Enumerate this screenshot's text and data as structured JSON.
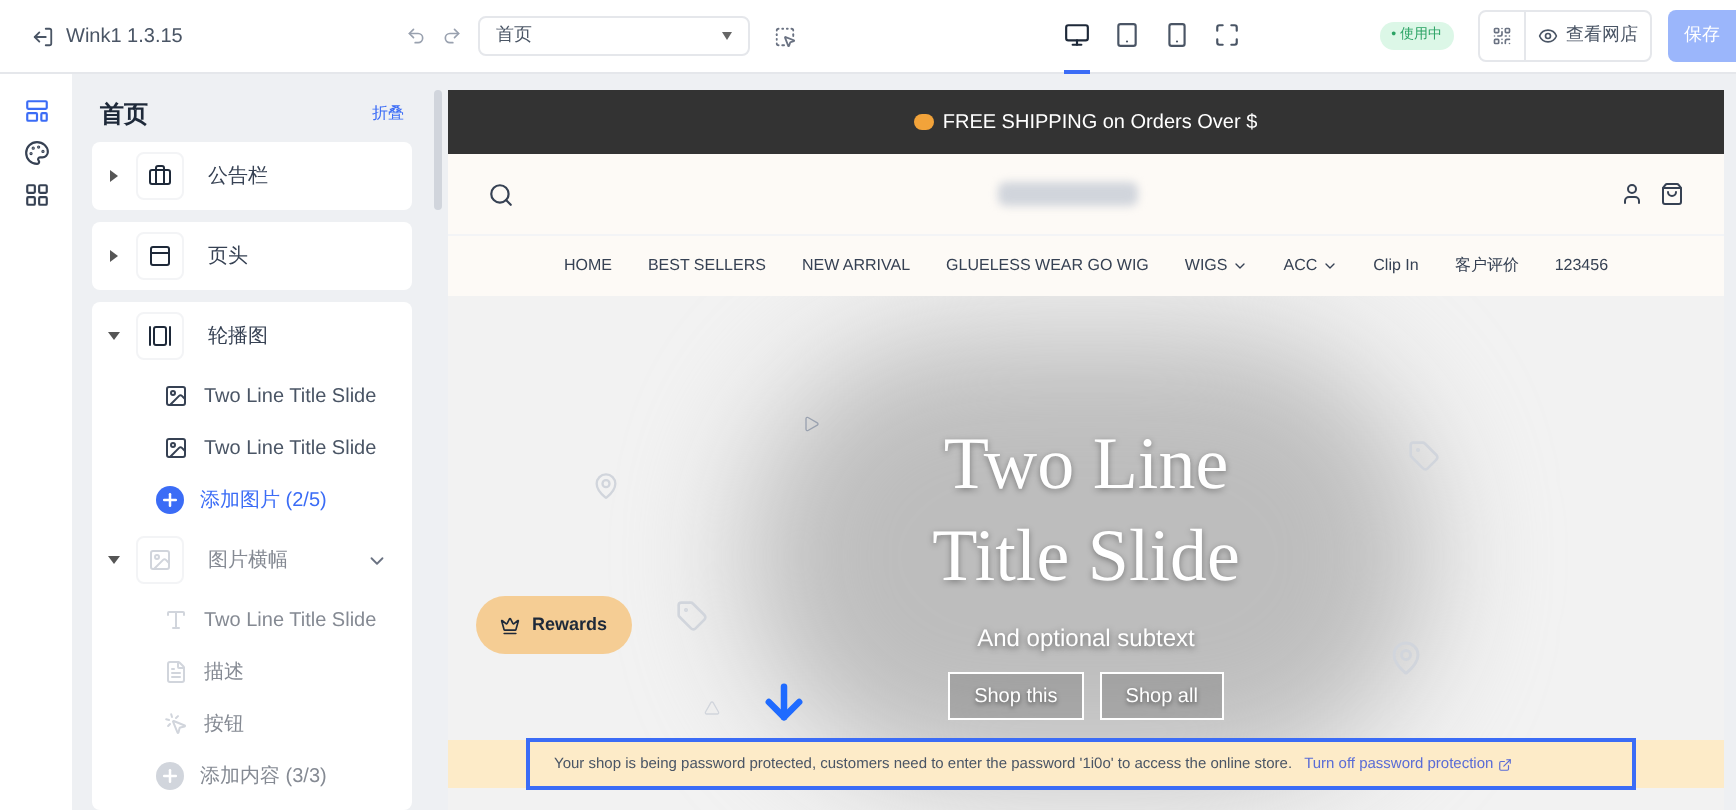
{
  "app": {
    "title": "Wink1 1.3.15"
  },
  "page_select": {
    "value": "首页"
  },
  "devices": [
    {
      "kind": "desktop",
      "selected": true
    },
    {
      "kind": "tablet",
      "selected": false
    },
    {
      "kind": "mobile",
      "selected": false
    },
    {
      "kind": "fullscreen",
      "selected": false
    }
  ],
  "status_badge": "• 使用中",
  "view_store_button": "查看网店",
  "save_button": {
    "label": "保存",
    "disabled": true
  },
  "rail": [
    {
      "kind": "layout",
      "selected": true
    },
    {
      "kind": "theme",
      "selected": false
    },
    {
      "kind": "apps",
      "selected": false
    }
  ],
  "sidebar": {
    "title": "首页",
    "collapse_link": "折叠",
    "sections": [
      {
        "kind": "announcement",
        "label": "公告栏",
        "expanded": false,
        "disabled": false
      },
      {
        "kind": "header",
        "label": "页头",
        "expanded": false,
        "disabled": false
      },
      {
        "kind": "slideshow",
        "label": "轮播图",
        "expanded": true,
        "disabled": false,
        "children": [
          {
            "kind": "image",
            "label": "Two Line Title Slide"
          },
          {
            "kind": "image",
            "label": "Two Line Title Slide"
          },
          {
            "kind": "add",
            "label": "添加图片 (2/5)"
          }
        ]
      },
      {
        "kind": "banner",
        "label": "图片横幅",
        "expanded": true,
        "disabled": true,
        "children": [
          {
            "kind": "text",
            "label": "Two Line Title Slide"
          },
          {
            "kind": "description",
            "label": "描述"
          },
          {
            "kind": "button",
            "label": "按钮"
          },
          {
            "kind": "add",
            "label": "添加内容 (3/3)"
          }
        ]
      }
    ]
  },
  "preview": {
    "announcement": "FREE SHIPPING on Orders Over $",
    "nav": [
      {
        "label": "HOME",
        "dropdown": false
      },
      {
        "label": "BEST SELLERS",
        "dropdown": false
      },
      {
        "label": "NEW ARRIVAL",
        "dropdown": false
      },
      {
        "label": "GLUELESS WEAR GO WIG",
        "dropdown": false
      },
      {
        "label": "WIGS",
        "dropdown": true
      },
      {
        "label": "ACC",
        "dropdown": true
      },
      {
        "label": "Clip In",
        "dropdown": false
      },
      {
        "label": "客户评价",
        "dropdown": false
      },
      {
        "label": "123456",
        "dropdown": false
      }
    ],
    "hero": {
      "title_lines": [
        "Two Line",
        "Title Slide"
      ],
      "subtext": "And optional subtext",
      "buttons": [
        "Shop this",
        "Shop all"
      ]
    },
    "rewards": "Rewards",
    "password_notice": "Your shop is being password protected, customers need to enter the password '1i0o' to access the online store.",
    "password_link": "Turn off password protection"
  }
}
